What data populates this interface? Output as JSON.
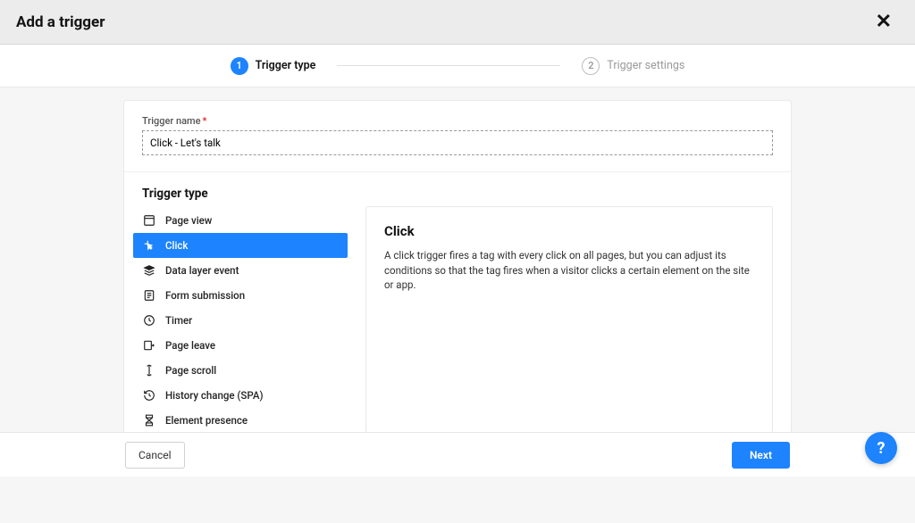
{
  "header": {
    "title": "Add a trigger"
  },
  "stepper": {
    "steps": [
      {
        "num": "1",
        "label": "Trigger type",
        "active": true
      },
      {
        "num": "2",
        "label": "Trigger settings",
        "active": false
      }
    ]
  },
  "form": {
    "name_label": "Trigger name",
    "name_value": "Click - Let's talk",
    "type_heading": "Trigger type",
    "types": [
      {
        "id": "page-view",
        "label": "Page view",
        "icon": "page-view-icon"
      },
      {
        "id": "click",
        "label": "Click",
        "icon": "click-icon",
        "selected": true
      },
      {
        "id": "data-layer-event",
        "label": "Data layer event",
        "icon": "data-layer-icon"
      },
      {
        "id": "form-submission",
        "label": "Form submission",
        "icon": "form-icon"
      },
      {
        "id": "timer",
        "label": "Timer",
        "icon": "timer-icon"
      },
      {
        "id": "page-leave",
        "label": "Page leave",
        "icon": "page-leave-icon"
      },
      {
        "id": "page-scroll",
        "label": "Page scroll",
        "icon": "scroll-icon"
      },
      {
        "id": "history-change",
        "label": "History change (SPA)",
        "icon": "history-icon"
      },
      {
        "id": "element-presence",
        "label": "Element presence",
        "icon": "presence-icon"
      }
    ],
    "description": {
      "title": "Click",
      "text": "A click trigger fires a tag with every click on all pages, but you can adjust its conditions so that the tag fires when a visitor clicks a certain element on the site or app."
    }
  },
  "footer": {
    "cancel": "Cancel",
    "next": "Next"
  },
  "help": "?"
}
